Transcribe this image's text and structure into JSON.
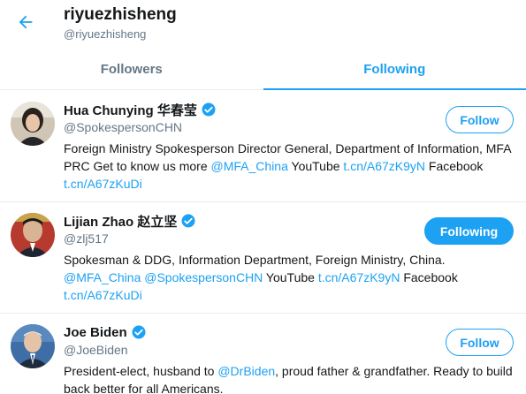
{
  "header": {
    "title": "riyuezhisheng",
    "handle": "@riyuezhisheng"
  },
  "tabs": [
    {
      "label": "Followers",
      "active": false
    },
    {
      "label": "Following",
      "active": true
    }
  ],
  "colors": {
    "accent": "#1da1f2",
    "text": "#14171a",
    "muted": "#657786",
    "divider": "#e6ecf0"
  },
  "users": [
    {
      "name": "Hua Chunying 华春莹",
      "handle": "@SpokespersonCHN",
      "verified": true,
      "button": "Follow",
      "bio_parts": [
        {
          "text": "Foreign Ministry Spokesperson Director General, Department of Information, MFA PRC Get to know us more ",
          "link": false
        },
        {
          "text": "@MFA_China",
          "link": true
        },
        {
          "text": " YouTube ",
          "link": false
        },
        {
          "text": "t.cn/A67zK9yN",
          "link": true
        },
        {
          "text": " Facebook ",
          "link": false
        },
        {
          "text": "t.cn/A67zKuDi",
          "link": true
        }
      ]
    },
    {
      "name": "Lijian Zhao 赵立坚",
      "handle": "@zlj517",
      "verified": true,
      "button": "Following",
      "bio_parts": [
        {
          "text": "Spokesman & DDG, Information Department, Foreign Ministry, China. ",
          "link": false
        },
        {
          "text": "@MFA_China",
          "link": true
        },
        {
          "text": " ",
          "link": false
        },
        {
          "text": "@SpokespersonCHN",
          "link": true
        },
        {
          "text": " YouTube ",
          "link": false
        },
        {
          "text": "t.cn/A67zK9yN",
          "link": true
        },
        {
          "text": " Facebook ",
          "link": false
        },
        {
          "text": "t.cn/A67zKuDi",
          "link": true
        }
      ]
    },
    {
      "name": "Joe Biden",
      "handle": "@JoeBiden",
      "verified": true,
      "button": "Follow",
      "bio_parts": [
        {
          "text": "President-elect, husband to ",
          "link": false
        },
        {
          "text": "@DrBiden",
          "link": true
        },
        {
          "text": ", proud father & grandfather. Ready to build back better for all Americans.",
          "link": false
        }
      ]
    }
  ]
}
